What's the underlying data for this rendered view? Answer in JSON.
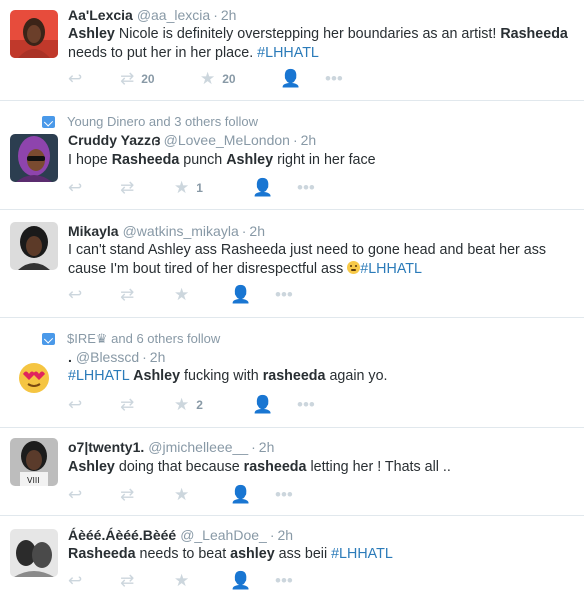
{
  "tweets": [
    {
      "context": "",
      "name": "Aa'Lexcia",
      "handle": "@aa_lexcia",
      "time": "2h",
      "text": [
        {
          "t": "Ashley",
          "b": true
        },
        {
          "t": " Nicole is definitely overstepping her boundaries as an artist! ",
          "b": false
        },
        {
          "t": "Rasheeda",
          "b": true
        },
        {
          "t": " needs to put her in her place. ",
          "b": false
        },
        {
          "t": "#LHHATL",
          "h": true
        }
      ],
      "retweets": "20",
      "favorites": "20",
      "avatar_color": "#c0392b"
    },
    {
      "context": "Young Dinero and 3 others follow",
      "name": "Cruddy Yazzദ",
      "handle": "@Lovee_MeLondon",
      "time": "2h",
      "text": [
        {
          "t": "I hope ",
          "b": false
        },
        {
          "t": "Rasheeda",
          "b": true
        },
        {
          "t": " punch ",
          "b": false
        },
        {
          "t": "Ashley",
          "b": true
        },
        {
          "t": " right in her face",
          "b": false
        }
      ],
      "retweets": "",
      "favorites": "1",
      "avatar_color": "#7d3c98"
    },
    {
      "context": "",
      "name": "Mikayla",
      "handle": "@watkins_mikayla",
      "time": "2h",
      "text": [
        {
          "t": "I can't stand Ashley ass Rasheeda just need to gone head and beat her ass cause I'm bout tired of her disrespectful ass ",
          "b": false
        },
        {
          "emoji": "angry"
        },
        {
          "t": "#LHHATL",
          "h": true
        }
      ],
      "retweets": "",
      "favorites": "",
      "avatar_color": "#3d3d3d"
    },
    {
      "context": "$IRE♛ and 6 others follow",
      "name": ".",
      "handle": "@Blesscd",
      "time": "2h",
      "text": [
        {
          "t": "#LHHATL",
          "h": true
        },
        {
          "t": " ",
          "b": false
        },
        {
          "t": "Ashley",
          "b": true
        },
        {
          "t": " fucking with ",
          "b": false
        },
        {
          "t": "rasheeda",
          "b": true
        },
        {
          "t": " again yo.",
          "b": false
        }
      ],
      "retweets": "",
      "favorites": "2",
      "avatar_color": "#f5c542"
    },
    {
      "context": "",
      "name": "o7|twenty1.",
      "handle": "@jmichelleee__",
      "time": "2h",
      "text": [
        {
          "t": "Ashley",
          "b": true
        },
        {
          "t": " doing that because ",
          "b": false
        },
        {
          "t": "rasheeda",
          "b": true
        },
        {
          "t": " letting her !  Thats all ..",
          "b": false
        }
      ],
      "retweets": "",
      "favorites": "",
      "avatar_color": "#555555"
    },
    {
      "context": "",
      "name": "Áèéé.Áèéé.Bèéé",
      "handle": "@_LeahDoe_",
      "time": "2h",
      "text": [
        {
          "t": "Rasheeda",
          "b": true
        },
        {
          "t": " needs to beat ",
          "b": false
        },
        {
          "t": "ashley",
          "b": true
        },
        {
          "t": " ass beii ",
          "b": false
        },
        {
          "t": "#LHHATL",
          "h": true
        }
      ],
      "retweets": "",
      "favorites": "",
      "avatar_color": "#6b6b6b"
    }
  ],
  "icons": {
    "reply": "reply-icon",
    "retweet": "retweet-icon",
    "favorite": "star-icon",
    "follow": "follow-icon",
    "more": "more-icon"
  },
  "colors": {
    "hashtag": "#2b7bb9",
    "muted": "#8899a6",
    "icon": "#ccd6dd",
    "divider": "#e1e8ed"
  }
}
